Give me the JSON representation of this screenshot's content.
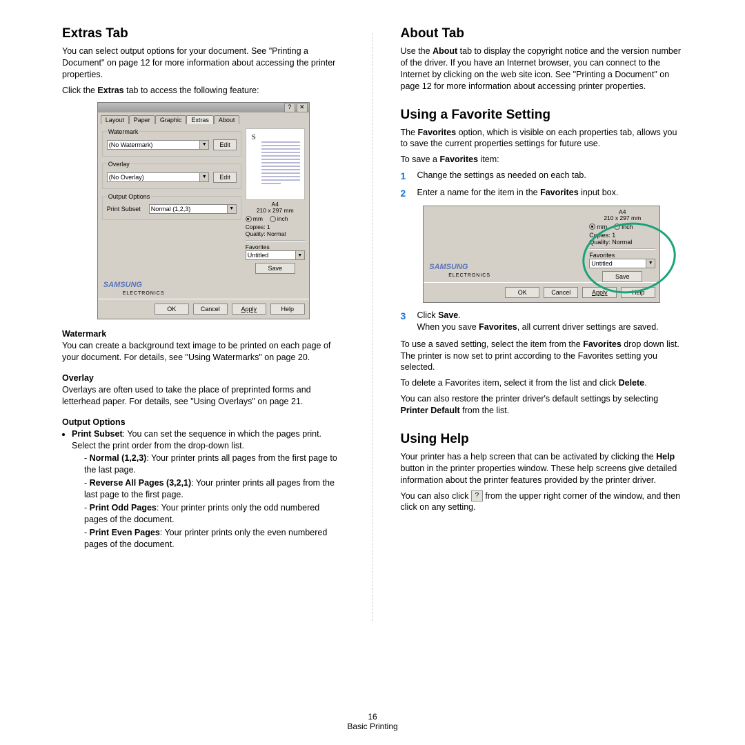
{
  "left": {
    "h1": "Extras Tab",
    "p1": "You can select output options for your document. See \"Printing a Document\" on page 12 for more information about accessing the printer properties.",
    "p2a": "Click the ",
    "p2b": "Extras",
    "p2c": " tab to access the following feature:",
    "watermark": {
      "title": "Watermark",
      "text": "You can create a background text image to be printed on each page of your document. For details, see \"Using Watermarks\" on page 20."
    },
    "overlay": {
      "title": "Overlay",
      "text": "Overlays are often used to take the place of preprinted forms and letterhead paper. For details, see \"Using Overlays\" on page 21."
    },
    "output": {
      "title": "Output Options",
      "bullet_lead_b": "Print Subset",
      "bullet_lead_t": ": You can set the sequence in which the pages print. Select the print order from the drop-down list.",
      "opts": [
        {
          "b": "Normal (1,2,3)",
          "t": ": Your printer prints all pages from the first page to the last page."
        },
        {
          "b": "Reverse All Pages (3,2,1)",
          "t": ": Your printer prints all pages from the last page to the first page."
        },
        {
          "b": "Print Odd Pages",
          "t": ": Your printer prints only the odd numbered pages of the document."
        },
        {
          "b": "Print Even Pages",
          "t": ": Your printer prints only the even numbered pages of the document."
        }
      ]
    }
  },
  "dialog": {
    "tabs": [
      "Layout",
      "Paper",
      "Graphic",
      "Extras",
      "About"
    ],
    "active_tab": "Extras",
    "watermark": {
      "legend": "Watermark",
      "value": "(No Watermark)",
      "edit": "Edit"
    },
    "overlay": {
      "legend": "Overlay",
      "value": "(No Overlay)",
      "edit": "Edit"
    },
    "output": {
      "legend": "Output Options",
      "label": "Print Subset",
      "value": "Normal (1,2,3)"
    },
    "preview_letter": "S",
    "paper_caption_1": "A4",
    "paper_caption_2": "210 x 297 mm",
    "unit_mm": "mm",
    "unit_inch": "inch",
    "copies": "Copies: 1",
    "quality": "Quality: Normal",
    "fav_legend": "Favorites",
    "fav_value": "Untitled",
    "save": "Save",
    "brand": "SAMSUNG",
    "brand_sub": "ELECTRONICS",
    "ok": "OK",
    "cancel": "Cancel",
    "apply": "Apply",
    "help": "Help",
    "tbtn_help": "?",
    "tbtn_close": "✕"
  },
  "right": {
    "about": {
      "h": "About Tab",
      "p1a": "Use the ",
      "p1b": "About",
      "p1c": " tab to display the copyright notice and the version number of the driver. If you have an Internet browser, you can connect to the Internet by clicking on the web site icon. See \"Printing a Document\" on page 12 for more information about accessing printer properties."
    },
    "fav": {
      "h": "Using a Favorite Setting",
      "p1a": "The ",
      "p1b": "Favorites",
      "p1c": " option, which is visible on each properties tab, allows you to save the current properties settings for future use.",
      "p2a": "To save a ",
      "p2b": "Favorites",
      "p2c": " item:",
      "step1": "Change the settings as needed on each tab.",
      "step2a": "Enter a name for the item in the ",
      "step2b": "Favorites",
      "step2c": " input box.",
      "step3a": "Click ",
      "step3b": "Save",
      "step3c": ".",
      "step3_p_a": "When you save ",
      "step3_p_b": "Favorites",
      "step3_p_c": ", all current driver settings are saved.",
      "p3a": "To use a saved setting, select the item from the ",
      "p3b": "Favorites",
      "p3c": " drop down list. The printer is now set to print according to the Favorites setting you selected.",
      "p4a": "To delete a Favorites item, select it from the list and click ",
      "p4b": "Delete",
      "p4c": ".",
      "p5a": "You can also restore the printer driver's default settings by selecting ",
      "p5b": "Printer Default",
      "p5c": " from the list."
    },
    "help": {
      "h": "Using Help",
      "p1a": "Your printer has a help screen that can be activated by clicking the ",
      "p1b": "Help",
      "p1c": " button in the printer properties window. These help screens give detailed information about the printer features provided by the printer driver.",
      "p2a": "You can also click ",
      "p2b": "?",
      "p2c": " from the upper right corner of the window, and then click on any setting."
    }
  },
  "dlg2": {
    "paper_caption_1": "A4",
    "paper_caption_2": "210 x 297 mm",
    "unit_mm": "mm",
    "unit_inch": "inch",
    "copies": "Copies: 1",
    "quality": "Quality: Normal",
    "fav_legend": "Favorites",
    "fav_value": "Untitled",
    "save": "Save",
    "brand": "SAMSUNG",
    "brand_sub": "ELECTRONICS",
    "ok": "OK",
    "cancel": "Cancel",
    "apply": "Apply",
    "help": "Help"
  },
  "footer": {
    "page": "16",
    "section": "Basic Printing"
  }
}
